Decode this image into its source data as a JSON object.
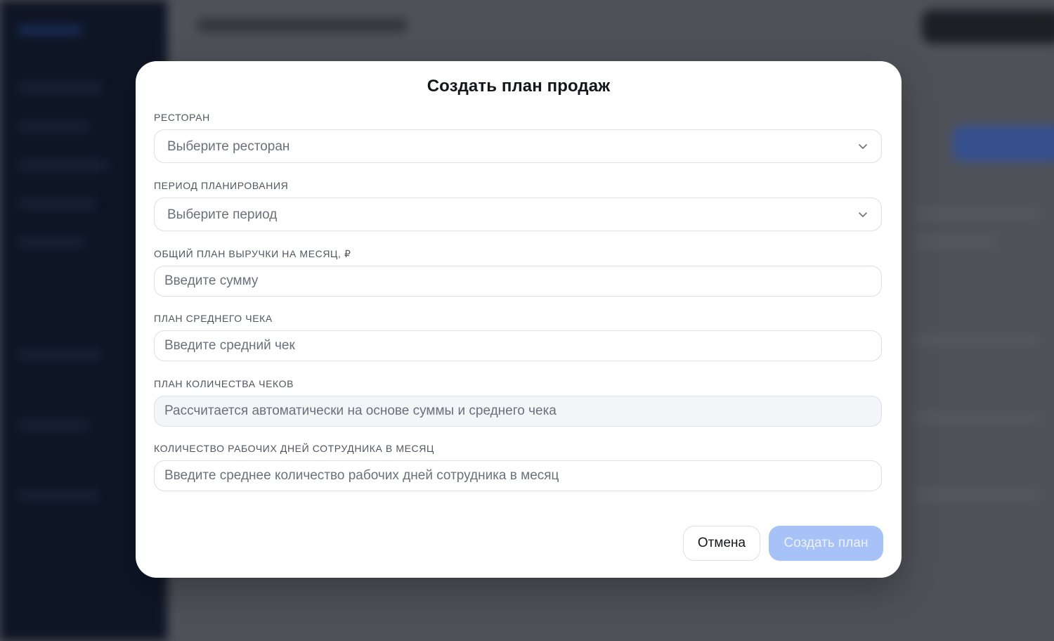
{
  "modal": {
    "title": "Создать план продаж",
    "fields": {
      "restaurant": {
        "label": "РЕСТОРАН",
        "value": "Выберите ресторан"
      },
      "period": {
        "label": "ПЕРИОД ПЛАНИРОВАНИЯ",
        "value": "Выберите период"
      },
      "revenue": {
        "label": "ОБЩИЙ ПЛАН ВЫРУЧКИ НА МЕСЯЦ, ₽",
        "placeholder": "Введите сумму"
      },
      "avg_check": {
        "label": "ПЛАН СРЕДНЕГО ЧЕКА",
        "placeholder": "Введите средний чек"
      },
      "checks_count": {
        "label": "ПЛАН КОЛИЧЕСТВА ЧЕКОВ",
        "placeholder": "Рассчитается автоматически на основе суммы и среднего чека"
      },
      "work_days": {
        "label": "КОЛИЧЕСТВО РАБОЧИХ ДНЕЙ СОТРУДНИКА В МЕСЯЦ",
        "placeholder": "Введите среднее количество рабочих дней сотрудника в месяц"
      }
    },
    "buttons": {
      "cancel": "Отмена",
      "create": "Создать план"
    }
  },
  "colors": {
    "primary_disabled": "#a7c2f7",
    "sidebar_bg": "#0d1628"
  },
  "icons": {
    "select_chevron": "chevron-down-icon"
  }
}
